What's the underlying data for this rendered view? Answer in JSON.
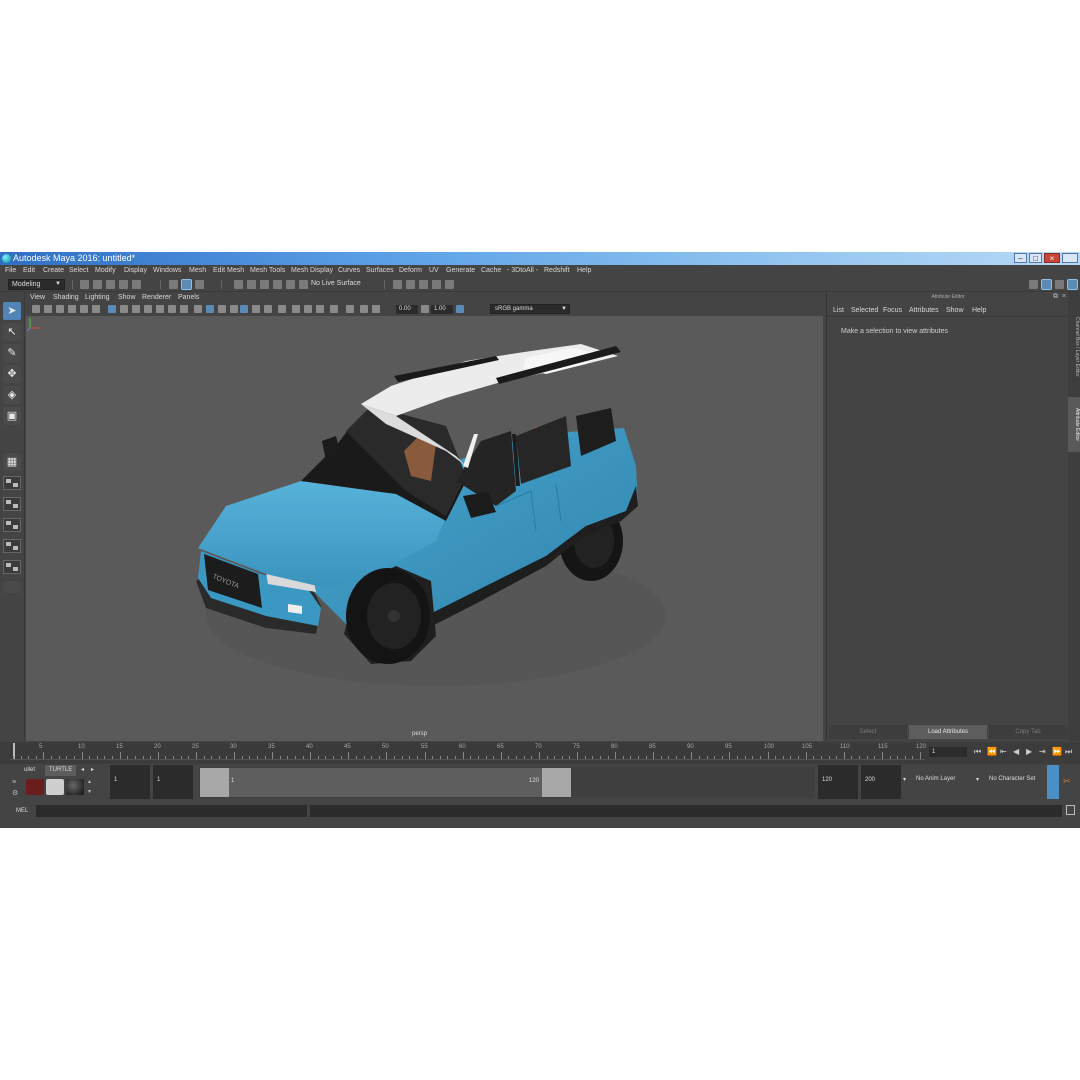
{
  "window": {
    "title": "Autodesk Maya 2016: untitled*",
    "controls": [
      "–",
      "□",
      "×"
    ]
  },
  "menu": [
    "File",
    "Edit",
    "Create",
    "Select",
    "Modify",
    "Display",
    "Windows",
    "Mesh",
    "Edit Mesh",
    "Mesh Tools",
    "Mesh Display",
    "Curves",
    "Surfaces",
    "Deform",
    "UV",
    "Generate",
    "Cache",
    "- 3DtoAll -",
    "Redshift",
    "Help"
  ],
  "status_line": {
    "menu_set": "Modeling",
    "live_surface": "No Live Surface"
  },
  "viewport": {
    "menu": [
      "View",
      "Shading",
      "Lighting",
      "Show",
      "Renderer",
      "Panels"
    ],
    "exposure": "0.00",
    "gamma_value": "1.00",
    "color_space": "sRGB gamma",
    "camera_label": "persp",
    "car_grille_text": "TOYOTA",
    "colors": {
      "background": "#5a5a5a",
      "body": "#3c96bf",
      "roof": "#e6e6e6",
      "interior": "#8a5a3c"
    }
  },
  "attribute_editor": {
    "header": "Attribute Editor",
    "tabs": [
      "List",
      "Selected",
      "Focus",
      "Attributes",
      "Show",
      "Help"
    ],
    "message": "Make a selection to view attributes",
    "buttons": {
      "select": "Select",
      "load": "Load Attributes",
      "copy": "Copy Tab"
    },
    "side_tabs": [
      "Channel Box / Layer Editor",
      "Attribute Editor"
    ]
  },
  "time_slider": {
    "ticks": [
      "5",
      "10",
      "15",
      "20",
      "25",
      "30",
      "35",
      "40",
      "45",
      "50",
      "55",
      "60",
      "65",
      "70",
      "75",
      "80",
      "85",
      "90",
      "95",
      "100",
      "105",
      "110",
      "115",
      "120"
    ],
    "current_frame": "1"
  },
  "range_slider": {
    "shelf_tabs": [
      "ullet",
      "TURTLE"
    ],
    "start_frame": "1",
    "playback_start": "1",
    "range_start_label": "1",
    "range_end_label": "120",
    "playback_end": "120",
    "end_frame": "200",
    "anim_layer": "No Anim Layer",
    "character_set": "No Character Set"
  },
  "command_line": {
    "label": "MEL"
  }
}
